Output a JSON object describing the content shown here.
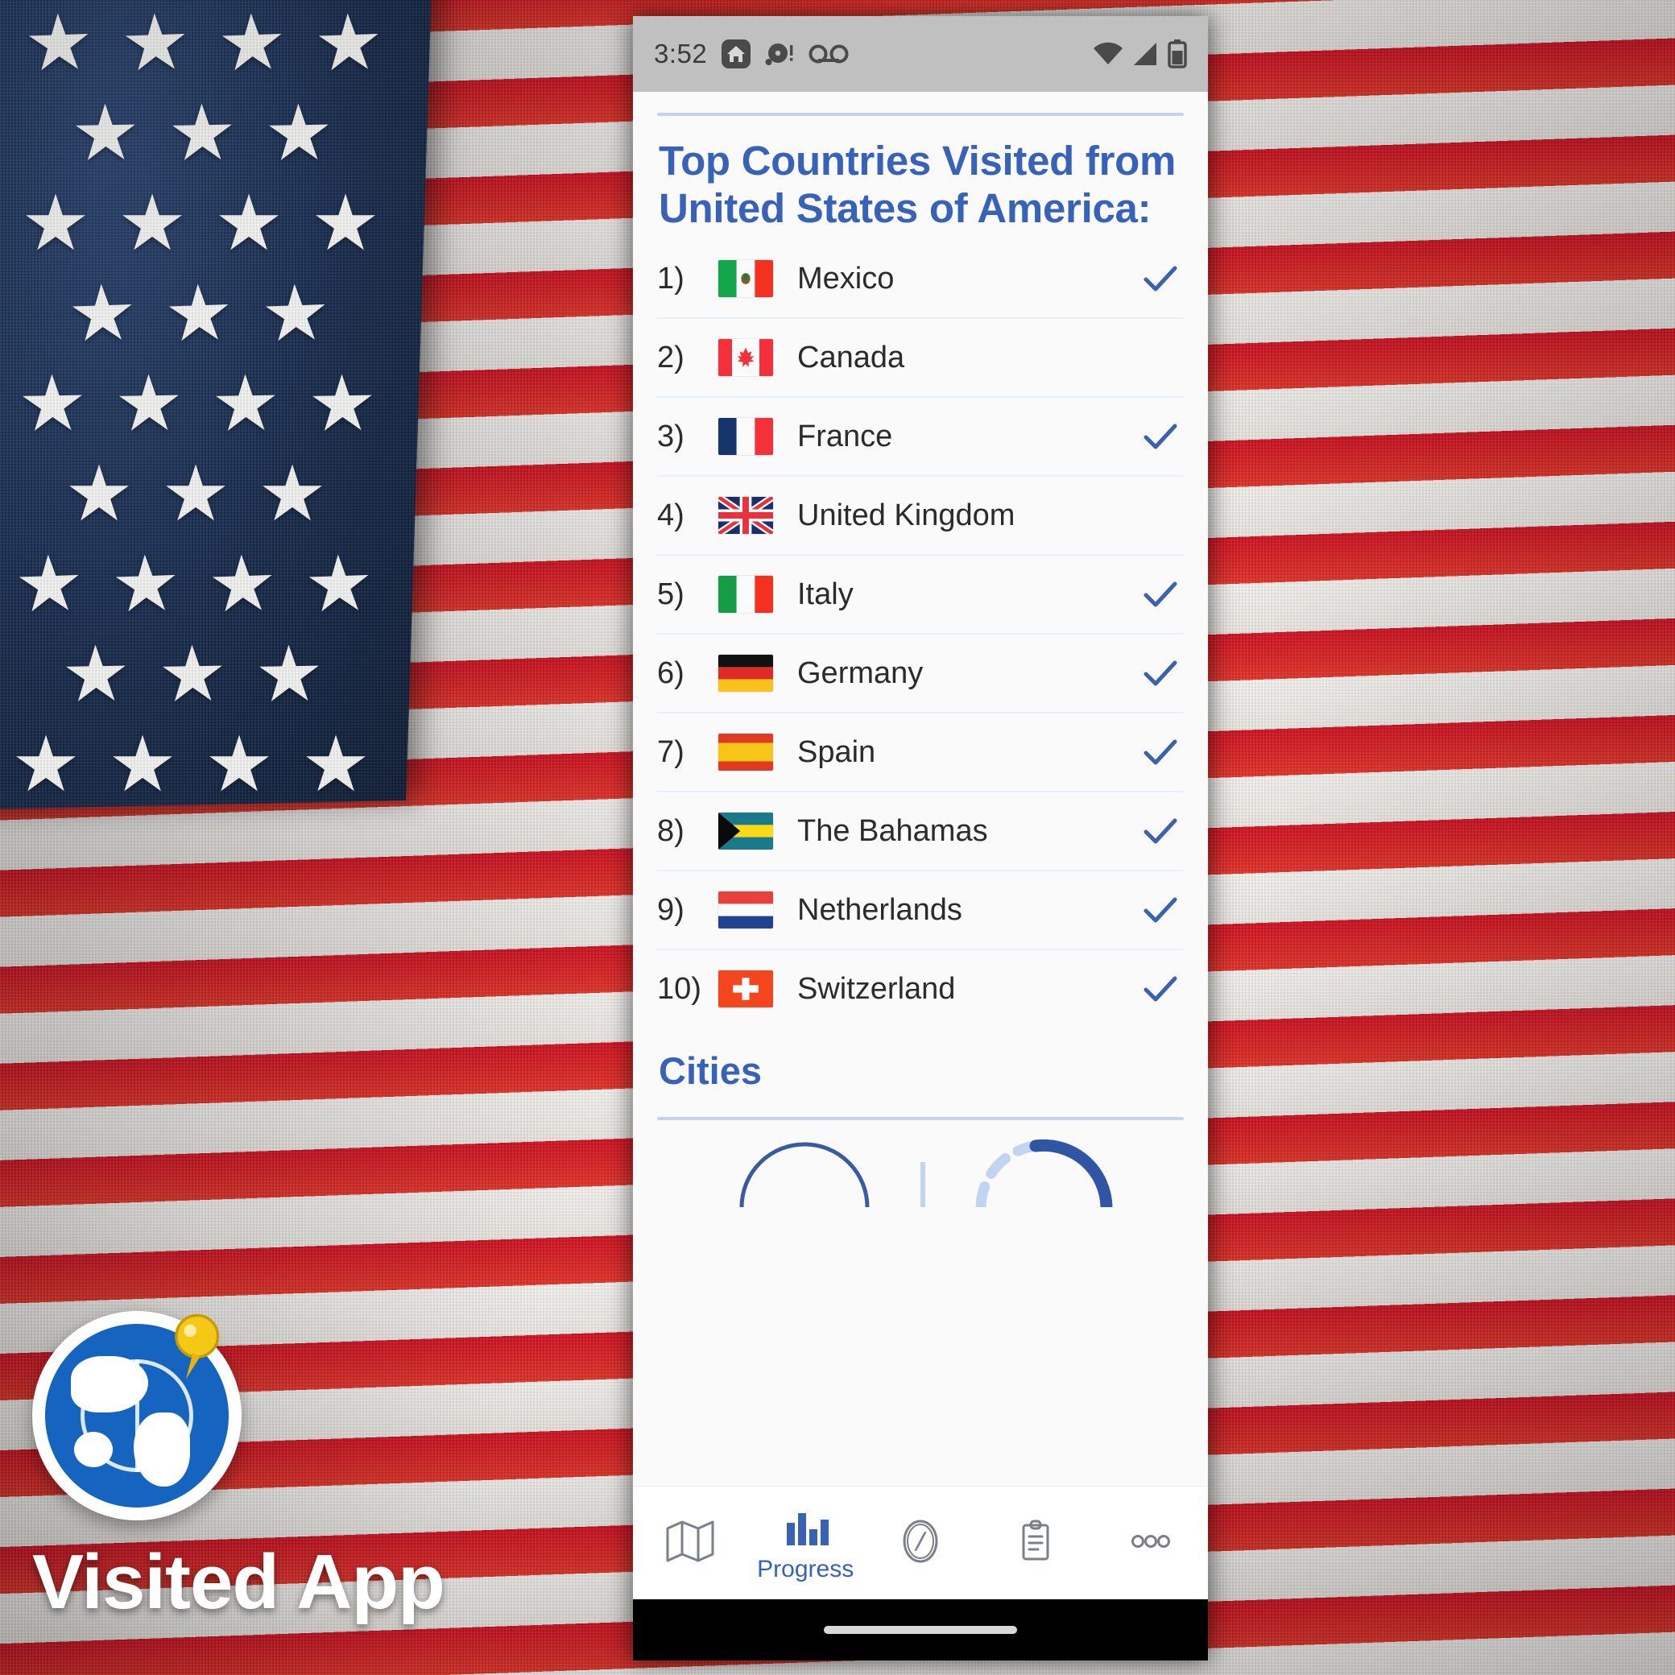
{
  "background": {
    "image_description": "United States flag close-up",
    "brand_name": "Visited App",
    "logo_icon": "globe-with-pin-icon"
  },
  "statusbar": {
    "time": "3:52",
    "left_icons": [
      "home-icon",
      "notification-dot-icon",
      "voicemail-icon"
    ],
    "right_icons": [
      "wifi-icon",
      "cellular-signal-icon",
      "battery-icon"
    ]
  },
  "header": {
    "title_line1": "Top Countries Visited from",
    "title_line2": "United States of America:",
    "accent_color": "#3762b8",
    "divider_color": "#c3d4f2"
  },
  "countries": [
    {
      "rank": "1)",
      "name": "Mexico",
      "flag": "mexico",
      "visited": true
    },
    {
      "rank": "2)",
      "name": "Canada",
      "flag": "canada",
      "visited": false
    },
    {
      "rank": "3)",
      "name": "France",
      "flag": "france",
      "visited": true
    },
    {
      "rank": "4)",
      "name": "United Kingdom",
      "flag": "uk",
      "visited": false
    },
    {
      "rank": "5)",
      "name": "Italy",
      "flag": "italy",
      "visited": true
    },
    {
      "rank": "6)",
      "name": "Germany",
      "flag": "germany",
      "visited": true
    },
    {
      "rank": "7)",
      "name": "Spain",
      "flag": "spain",
      "visited": true
    },
    {
      "rank": "8)",
      "name": "The Bahamas",
      "flag": "bahamas",
      "visited": true
    },
    {
      "rank": "9)",
      "name": "Netherlands",
      "flag": "netherlands",
      "visited": true
    },
    {
      "rank": "10)",
      "name": "Switzerland",
      "flag": "switzerland",
      "visited": true
    }
  ],
  "cities_section": {
    "heading": "Cities"
  },
  "bottom_nav": {
    "items": [
      {
        "icon": "map-icon",
        "label": "",
        "active": false
      },
      {
        "icon": "bar-chart-icon",
        "label": "Progress",
        "active": true
      },
      {
        "icon": "compass-icon",
        "label": "",
        "active": false
      },
      {
        "icon": "clipboard-icon",
        "label": "",
        "active": false
      },
      {
        "icon": "more-dots-icon",
        "label": "",
        "active": false
      }
    ]
  }
}
